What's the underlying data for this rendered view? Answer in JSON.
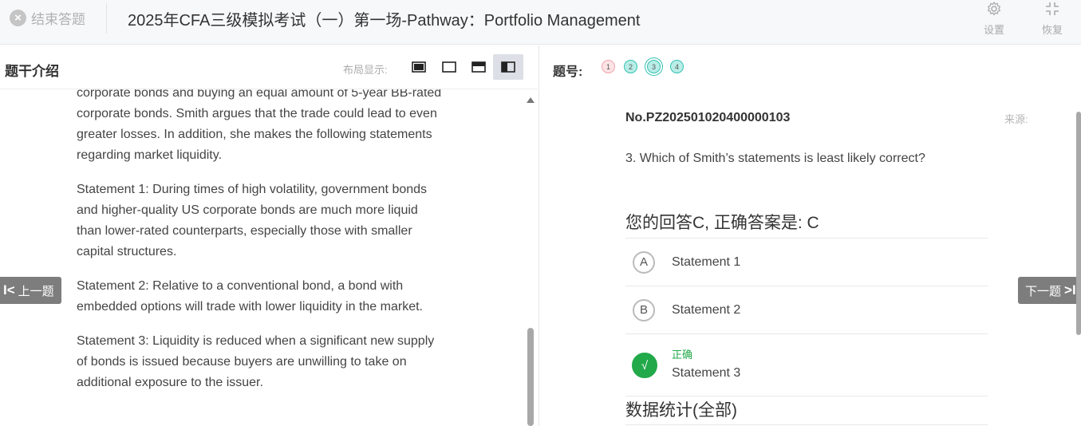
{
  "header": {
    "end_label": "结束答题",
    "title": "2025年CFA三级模拟考试（一）第一场-Pathway：Portfolio Management",
    "settings_label": "设置",
    "restore_label": "恢复"
  },
  "left": {
    "title": "题干介绍",
    "layout_label": "布局显示:",
    "passage": [
      "corporate bonds and buying an equal amount of 5-year BB-rated corporate bonds. Smith argues that the trade could lead to even greater losses. In addition, she makes the following statements regarding market liquidity.",
      "Statement 1: During times of high volatility, government bonds and higher-quality US corporate bonds are much more liquid than lower-rated counterparts, especially those with smaller capital structures.",
      "Statement 2: Relative to a conventional bond, a bond with embedded options will trade with lower liquidity in the market.",
      "Statement 3: Liquidity is reduced when a significant new supply of bonds is issued because buyers are unwilling to take on additional exposure to the issuer."
    ]
  },
  "nav": {
    "prev_label": "上一题",
    "next_label": "下一题"
  },
  "right": {
    "qn_label": "题号:",
    "question_numbers": [
      "1",
      "2",
      "3",
      "4"
    ],
    "question_id": "No.PZ202501020400000103",
    "source_label": "来源:",
    "question_text": "3. Which of Smith’s statements is least likely correct?",
    "answer_heading": "您的回答C, 正确答案是: C",
    "options": [
      {
        "letter": "A",
        "text": "Statement 1"
      },
      {
        "letter": "B",
        "text": "Statement 2"
      },
      {
        "letter": "√",
        "tag": "正确",
        "text": "Statement 3"
      }
    ],
    "stats_heading": "数据统计(全部)"
  },
  "colors": {
    "correct_green": "#22a94a",
    "answered_teal": "#35c2b2",
    "wrong_pink": "#f0a4ae",
    "nav_grey": "#7d7d7d"
  }
}
